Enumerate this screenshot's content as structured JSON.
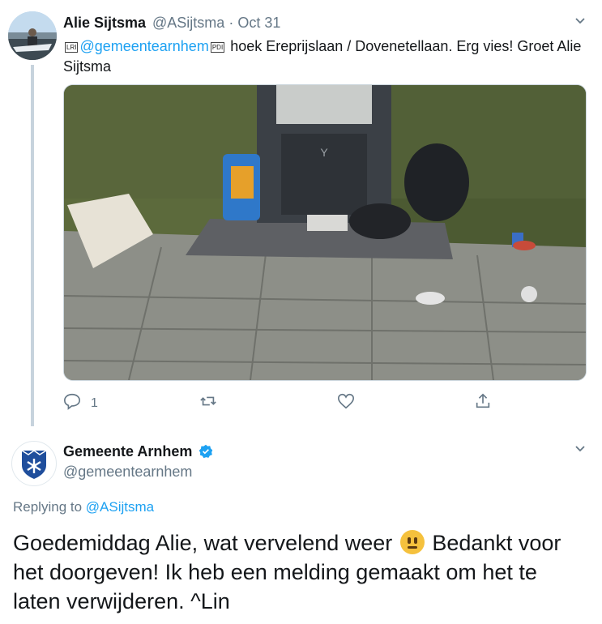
{
  "tweet1": {
    "author_name": "Alie Sijtsma",
    "author_handle": "@ASijtsma",
    "separator": "·",
    "date": "Oct 31",
    "lri_glyph": "LRI",
    "pdi_glyph": "PDI",
    "mention": "@gemeentearnhem",
    "text": "hoek Ereprijslaan / Dovenetellaan. Erg vies! Groet Alie Sijtsma",
    "reply_count": "1",
    "retweet_count": "",
    "like_count": ""
  },
  "tweet2": {
    "author_name": "Gemeente Arnhem",
    "author_handle": "@gemeentearnhem",
    "verified": true,
    "replying_prefix": "Replying to",
    "replying_to": "@ASijtsma",
    "text_part1": "Goedemiddag Alie, wat vervelend weer",
    "text_part2": "Bedankt voor het doorgeven! Ik heb een melding gemaakt om het te laten verwijderen. ^Lin"
  },
  "icons": {
    "reply": "reply-icon",
    "retweet": "retweet-icon",
    "like": "like-icon",
    "share": "share-icon",
    "caret": "chevron-down-icon",
    "verified": "verified-badge-icon",
    "emoji": "neutral-face-emoji"
  },
  "colors": {
    "link": "#1da1f2",
    "muted": "#657786",
    "text": "#14171a",
    "thread_line": "#c7d3dd"
  }
}
